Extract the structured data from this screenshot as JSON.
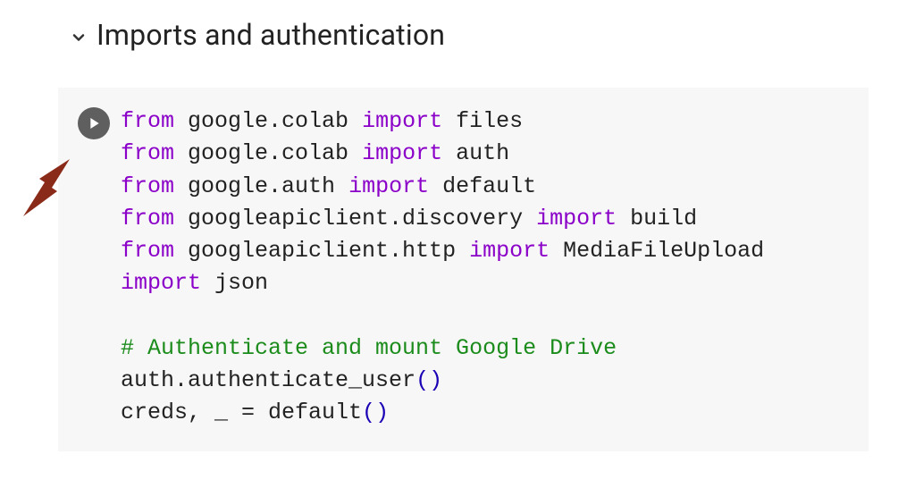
{
  "header": {
    "title": "Imports and authentication"
  },
  "code": {
    "lines": [
      {
        "type": "import",
        "from": "from",
        "module": "google.colab",
        "imp": "import",
        "name": "files"
      },
      {
        "type": "import",
        "from": "from",
        "module": "google.colab",
        "imp": "import",
        "name": "auth"
      },
      {
        "type": "import",
        "from": "from",
        "module": "google.auth",
        "imp": "import",
        "name": "default"
      },
      {
        "type": "import",
        "from": "from",
        "module": "googleapiclient.discovery",
        "imp": "import",
        "name": "build"
      },
      {
        "type": "import",
        "from": "from",
        "module": "googleapiclient.http",
        "imp": "import",
        "name": "MediaFileUpload"
      },
      {
        "type": "simple-import",
        "imp": "import",
        "name": "json"
      },
      {
        "type": "blank"
      },
      {
        "type": "comment",
        "text": "# Authenticate and mount Google Drive"
      },
      {
        "type": "call",
        "prefix": "auth.authenticate_user",
        "open": "(",
        "close": ")"
      },
      {
        "type": "call",
        "prefix": "creds, _ = default",
        "open": "(",
        "close": ")"
      }
    ]
  }
}
